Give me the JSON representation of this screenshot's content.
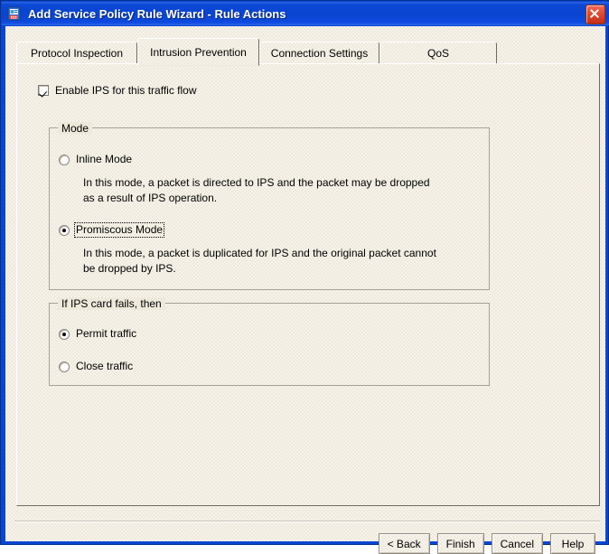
{
  "window": {
    "title": "Add Service Policy Rule Wizard - Rule Actions",
    "icon": "wizard-document-icon",
    "close_label": "✕",
    "accent_color": "#0a46d2",
    "face_color": "#efe9dc"
  },
  "tabs": [
    {
      "label": "Protocol Inspection",
      "active": false
    },
    {
      "label": "Intrusion Prevention",
      "active": true
    },
    {
      "label": "Connection Settings",
      "active": false
    },
    {
      "label": "QoS",
      "active": false
    }
  ],
  "enable_checkbox": {
    "label": "Enable IPS for this traffic flow",
    "checked": true
  },
  "mode_group": {
    "legend": "Mode",
    "options": [
      {
        "label": "Inline Mode",
        "selected": false,
        "focused": false,
        "description": "In this mode, a packet is directed to IPS and the packet may be dropped\nas a result of IPS operation."
      },
      {
        "label": "Promiscous Mode",
        "selected": true,
        "focused": true,
        "description": "In this mode, a packet is duplicated for IPS and the original packet cannot\nbe dropped by IPS."
      }
    ]
  },
  "failure_group": {
    "legend": "If IPS card fails, then",
    "options": [
      {
        "label": "Permit traffic",
        "selected": true
      },
      {
        "label": "Close traffic",
        "selected": false
      }
    ]
  },
  "buttons": [
    {
      "label": "< Back"
    },
    {
      "label": "Finish"
    },
    {
      "label": "Cancel"
    },
    {
      "label": "Help"
    }
  ]
}
